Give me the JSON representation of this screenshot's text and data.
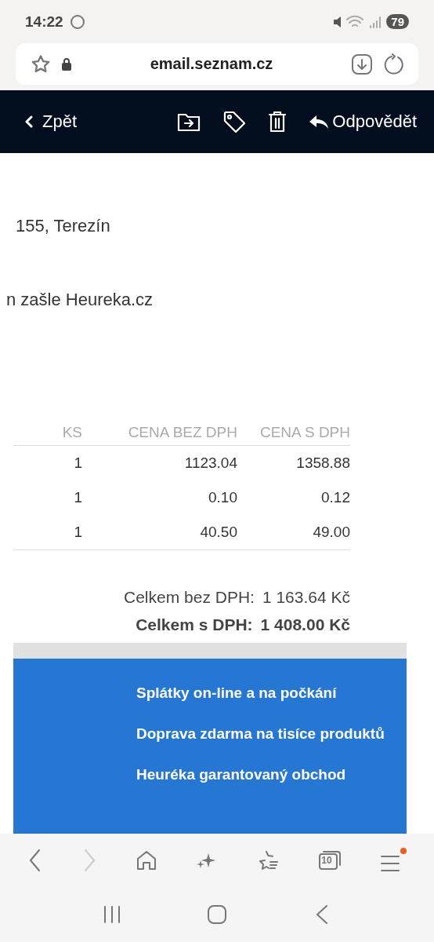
{
  "status_bar": {
    "time": "14:22",
    "battery": "79"
  },
  "url_bar": {
    "url": "email.seznam.cz"
  },
  "toolbar": {
    "back": "Zpět",
    "reply": "Odpovědět"
  },
  "email": {
    "lines": [
      "155, Terezín",
      "n zašle Heureka.cz"
    ],
    "table": {
      "columns": [
        "KS",
        "CENA BEZ DPH",
        "CENA S DPH"
      ],
      "rows": [
        [
          "1",
          "1123.04",
          "1358.88"
        ],
        [
          "1",
          "0.10",
          "0.12"
        ],
        [
          "1",
          "40.50",
          "49.00"
        ]
      ]
    },
    "totals": [
      {
        "label": "Celkem bez DPH:",
        "value": "1 163.64 Kč",
        "bold": false
      },
      {
        "label": "Celkem s DPH:",
        "value": "1 408.00 Kč",
        "bold": true
      }
    ],
    "banner": [
      "Splátky on-line a na počkání",
      "Doprava zdarma na tisíce produktů",
      "Heuréka garantovaný obchod"
    ]
  },
  "browser_nav": {
    "tab_count": "10",
    "menu_badge": true
  }
}
